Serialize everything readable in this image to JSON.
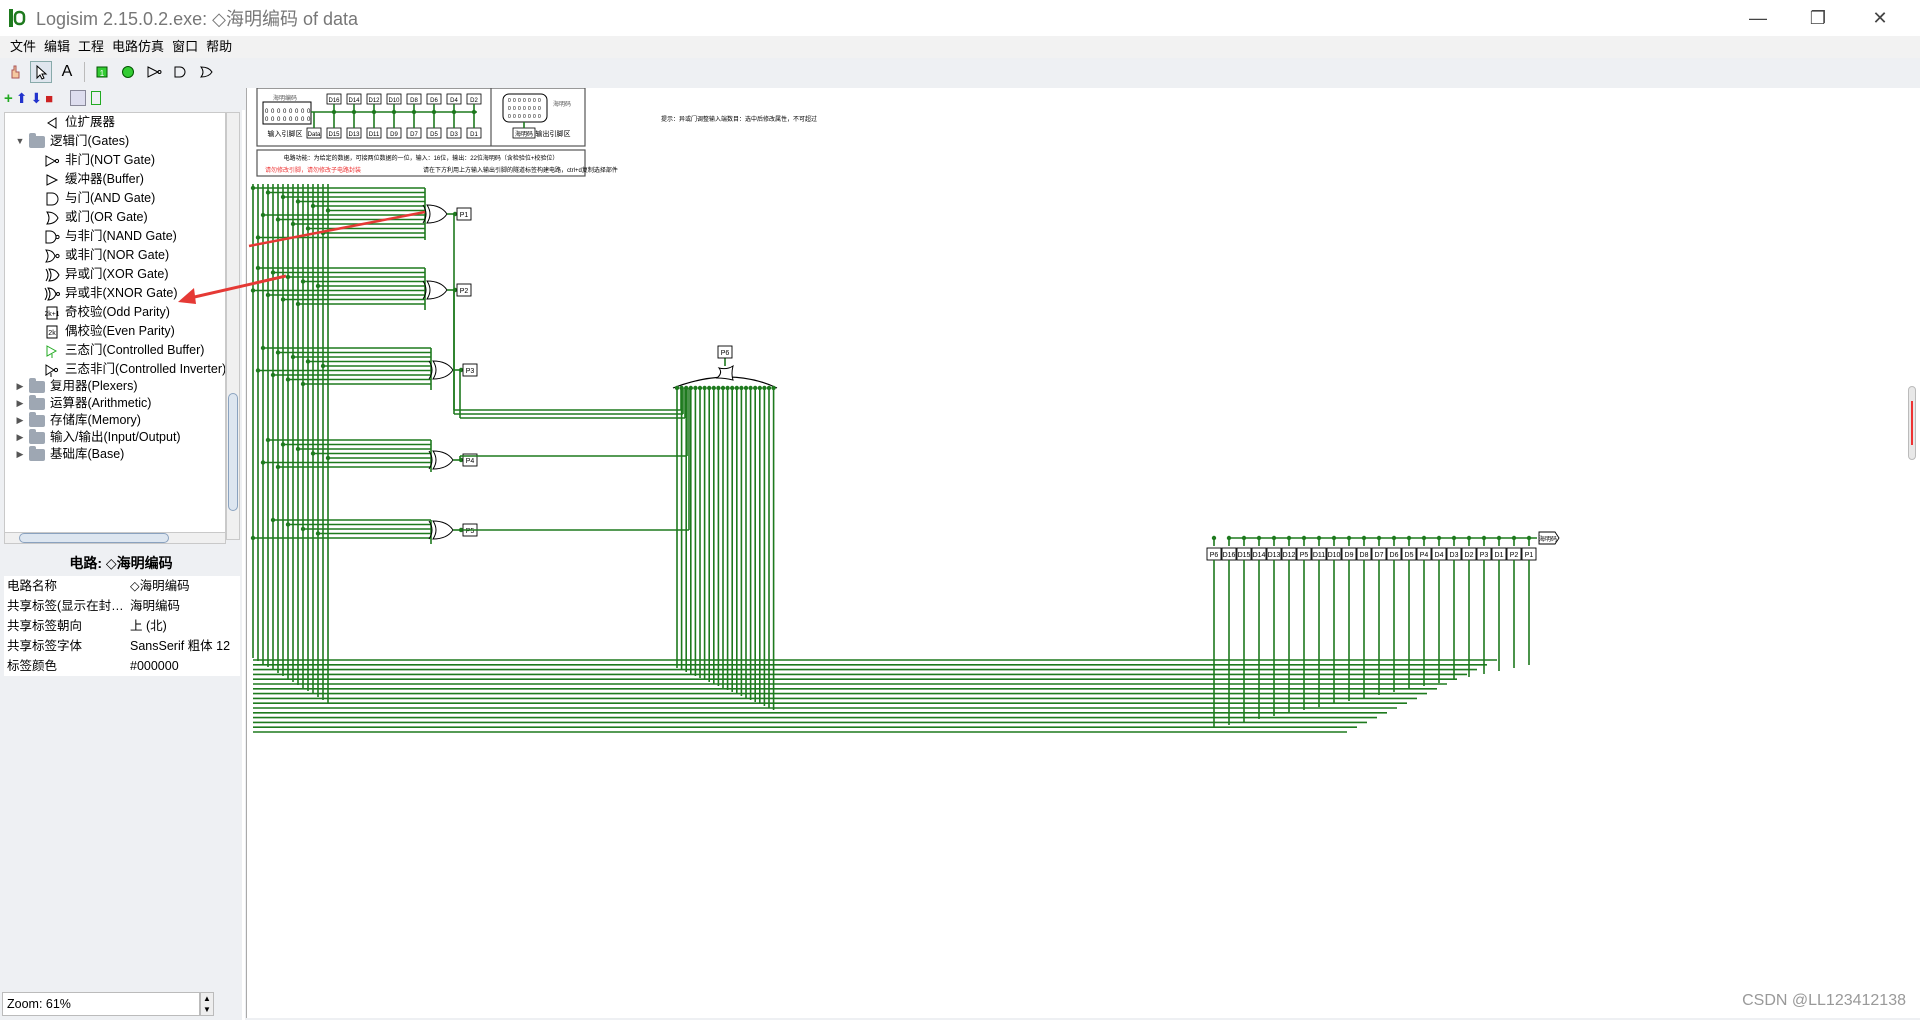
{
  "window": {
    "title": "Logisim 2.15.0.2.exe: ◇海明编码 of data"
  },
  "menu": [
    "文件",
    "编辑",
    "工程",
    "电路仿真",
    "窗口",
    "帮助"
  ],
  "tree": {
    "items": [
      {
        "kind": "leaf",
        "label": "位扩展器",
        "icon": "bit-extender-icon"
      },
      {
        "kind": "folder-open",
        "label": "逻辑门(Gates)"
      },
      {
        "kind": "gate",
        "label": "非门(NOT Gate)",
        "icon": "not-gate-icon"
      },
      {
        "kind": "gate",
        "label": "缓冲器(Buffer)",
        "icon": "buffer-icon"
      },
      {
        "kind": "gate",
        "label": "与门(AND Gate)",
        "icon": "and-gate-icon"
      },
      {
        "kind": "gate",
        "label": "或门(OR Gate)",
        "icon": "or-gate-icon"
      },
      {
        "kind": "gate",
        "label": "与非门(NAND Gate)",
        "icon": "nand-gate-icon"
      },
      {
        "kind": "gate",
        "label": "或非门(NOR Gate)",
        "icon": "nor-gate-icon"
      },
      {
        "kind": "gate",
        "label": "异或门(XOR Gate)",
        "icon": "xor-gate-icon"
      },
      {
        "kind": "gate",
        "label": "异或非(XNOR Gate)",
        "icon": "xnor-gate-icon"
      },
      {
        "kind": "gate",
        "label": "奇校验(Odd Parity)",
        "icon": "odd-parity-icon"
      },
      {
        "kind": "gate",
        "label": "偶校验(Even Parity)",
        "icon": "even-parity-icon"
      },
      {
        "kind": "gate",
        "label": "三态门(Controlled Buffer)",
        "icon": "controlled-buffer-icon"
      },
      {
        "kind": "gate",
        "label": "三态非门(Controlled Inverter)",
        "icon": "controlled-inverter-icon"
      },
      {
        "kind": "folder",
        "label": "复用器(Plexers)"
      },
      {
        "kind": "folder",
        "label": "运算器(Arithmetic)"
      },
      {
        "kind": "folder",
        "label": "存储库(Memory)"
      },
      {
        "kind": "folder",
        "label": "输入/输出(Input/Output)"
      },
      {
        "kind": "folder",
        "label": "基础库(Base)"
      }
    ]
  },
  "props": {
    "title": "电路: ◇海明编码",
    "rows": [
      {
        "k": "电路名称",
        "v": "◇海明编码"
      },
      {
        "k": "共享标签(显示在封…",
        "v": "海明编码"
      },
      {
        "k": "共享标签朝向",
        "v": "上 (北)"
      },
      {
        "k": "共享标签字体",
        "v": "SansSerif 粗体 12"
      },
      {
        "k": "标签颜色",
        "v": "#000000"
      }
    ]
  },
  "zoom": "Zoom: 61%",
  "canvas": {
    "header_inputs": [
      "D16",
      "D14",
      "D12",
      "D10",
      "D8",
      "D6",
      "D4",
      "D2"
    ],
    "header_inputs2": [
      "Data",
      "D15",
      "D13",
      "D11",
      "D9",
      "D7",
      "D5",
      "D3",
      "D1"
    ],
    "header_label_left": "输入引脚区",
    "header_label_right": "输出引脚区",
    "header_in_label": "海明编码",
    "header_out_label": "海明码",
    "note1": "电路功能：为给定的数据，可接两位数据的一位，输入：16位，输出：22位海明码（含检验位+校验位）",
    "note2": "请勿修改引脚，请勿修改子电路封装",
    "note3": "请在下方利用上方输入输出引脚的隧道标签构建电路，ctrl+d复制选择部件",
    "note_top": "提示：异或门调整输入端数目：选中后修改属性，不可超过",
    "parity_outputs": [
      "P1",
      "P2",
      "P3",
      "P4",
      "P5"
    ],
    "total_parity": "P6",
    "output_bus_labels": [
      "P6",
      "D16",
      "D15",
      "D14",
      "D13",
      "D12",
      "P5",
      "D11",
      "D10",
      "D9",
      "D8",
      "D7",
      "D6",
      "D5",
      "P4",
      "D4",
      "D3",
      "D2",
      "P3",
      "D1",
      "P2",
      "P1"
    ],
    "output_tunnel": "海明码"
  },
  "watermark": "CSDN @LL123412138",
  "colors": {
    "wire": "#1e7a1e",
    "arrow": "#e53935"
  }
}
